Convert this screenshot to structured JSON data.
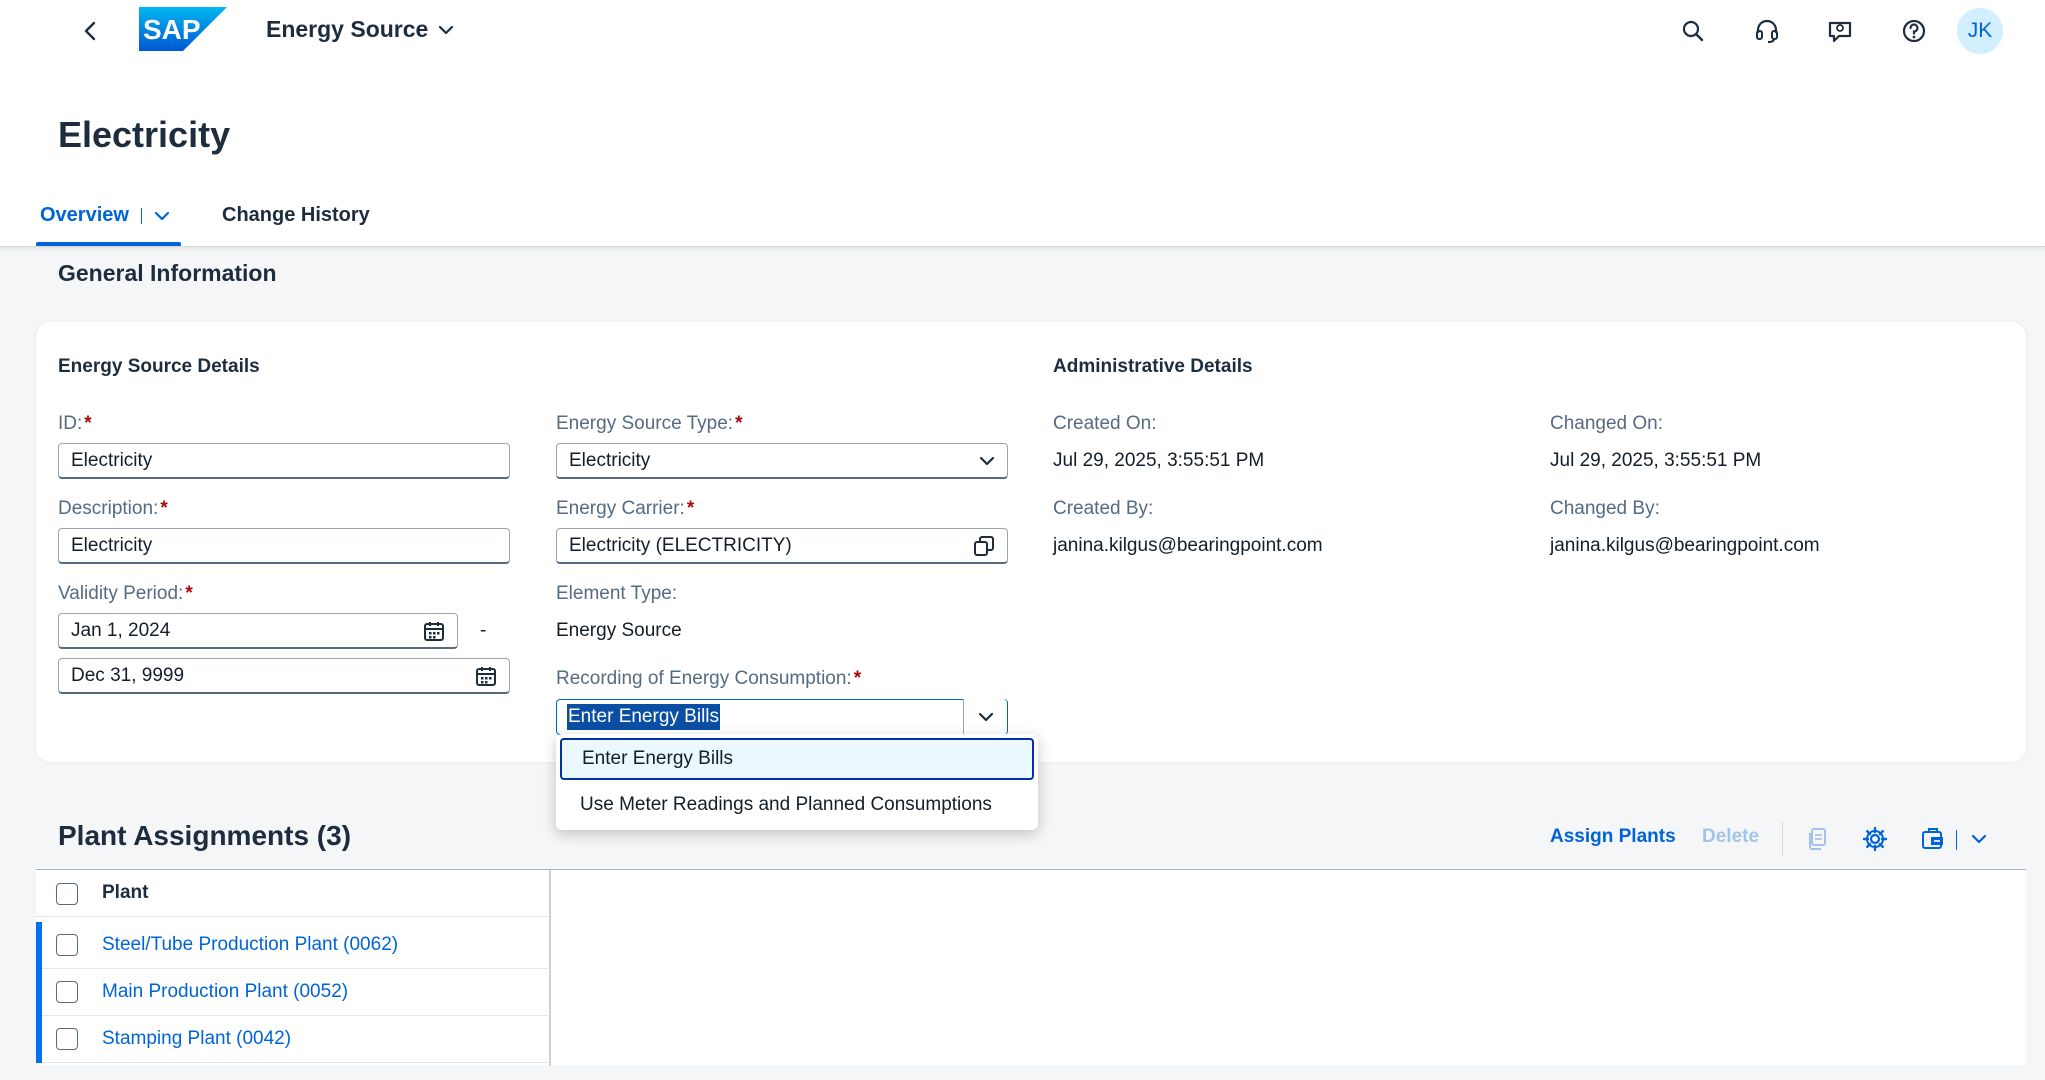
{
  "shell": {
    "logo_text": "SAP",
    "app_title": "Energy Source",
    "avatar_initials": "JK",
    "icons": [
      "back-icon",
      "search-icon",
      "headset-icon",
      "chat-icon",
      "help-icon"
    ]
  },
  "header": {
    "title": "Electricity",
    "tabs": [
      {
        "label": "Overview",
        "selected": true
      },
      {
        "label": "Change History",
        "selected": false
      }
    ]
  },
  "section": {
    "title": "General Information"
  },
  "energy_source_details": {
    "title": "Energy Source Details",
    "id_label": "ID:",
    "id_value": "Electricity",
    "description_label": "Description:",
    "description_value": "Electricity",
    "validity_label": "Validity Period:",
    "valid_from": "Jan 1, 2024",
    "valid_to": "Dec 31, 9999",
    "range_dash": "-",
    "source_type_label": "Energy Source Type:",
    "source_type_value": "Electricity",
    "carrier_label": "Energy Carrier:",
    "carrier_value": "Electricity (ELECTRICITY)",
    "element_type_label": "Element Type:",
    "element_type_value": "Energy Source",
    "recording_label": "Recording of Energy Consumption:",
    "recording_value": "Enter Energy Bills",
    "recording_options": [
      "Enter Energy Bills",
      "Use Meter Readings and Planned Consumptions"
    ]
  },
  "administrative_details": {
    "title": "Administrative Details",
    "created_on_label": "Created On:",
    "created_on_value": "Jul 29, 2025, 3:55:51 PM",
    "changed_on_label": "Changed On:",
    "changed_on_value": "Jul 29, 2025, 3:55:51 PM",
    "created_by_label": "Created By:",
    "created_by_value": "janina.kilgus@bearingpoint.com",
    "changed_by_label": "Changed By:",
    "changed_by_value": "janina.kilgus@bearingpoint.com"
  },
  "plant_assignments": {
    "title": "Plant Assignments (3)",
    "assign_label": "Assign Plants",
    "delete_label": "Delete",
    "column_header": "Plant",
    "rows": [
      "Steel/Tube Production Plant (0062)",
      "Main Production Plant (0052)",
      "Stamping Plant (0042)"
    ]
  },
  "colors": {
    "brand_blue": "#0064d9",
    "required": "#aa0808",
    "shell_bg": "#ffffff",
    "page_bg": "#f5f6f7"
  }
}
